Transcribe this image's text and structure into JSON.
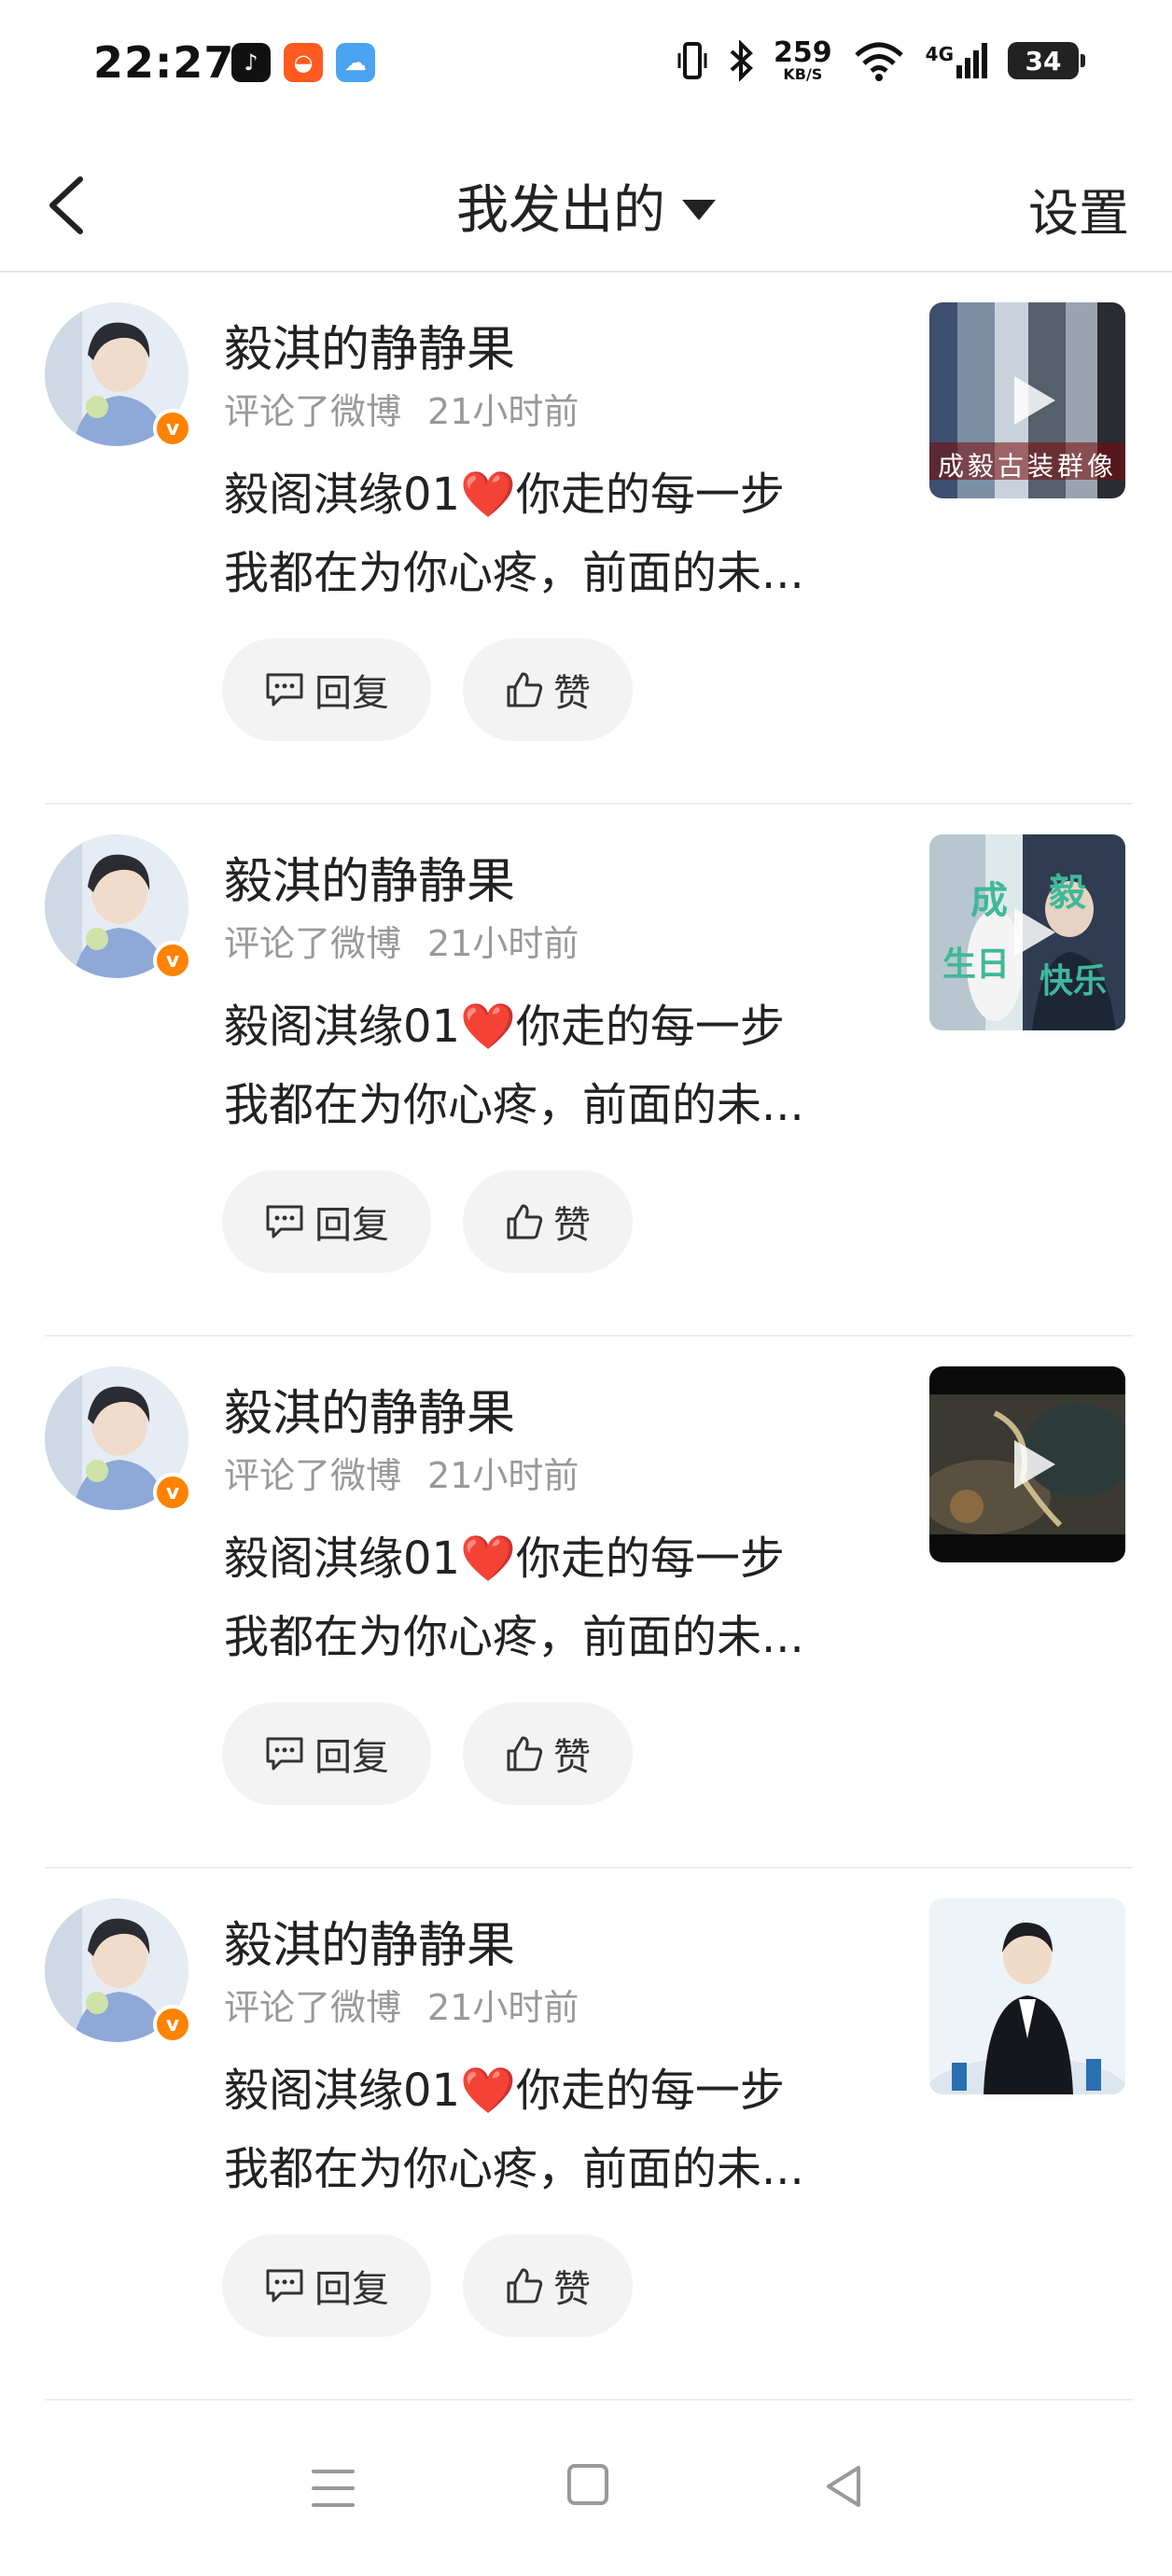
{
  "status_bar": {
    "time": "22:27",
    "net_speed": "259",
    "net_unit": "KB/S",
    "network": "4G",
    "battery": "34",
    "apps": [
      "tiktok-icon",
      "red-app-icon",
      "weather-icon"
    ]
  },
  "header": {
    "title": "我发出的",
    "settings": "设置"
  },
  "items": [
    {
      "name": "毅淇的静静果",
      "action": "评论了微博",
      "time": "21小时前",
      "text_a": "毅阁淇缘01",
      "heart": "❤️",
      "text_b": "你走的每一步",
      "line2": "我都在为你心疼，前面的未...",
      "reply": "回复",
      "like": "赞",
      "thumb": "video-collage"
    },
    {
      "name": "毅淇的静静果",
      "action": "评论了微博",
      "time": "21小时前",
      "text_a": "毅阁淇缘01",
      "heart": "❤️",
      "text_b": "你走的每一步",
      "line2": "我都在为你心疼，前面的未...",
      "reply": "回复",
      "like": "赞",
      "thumb": "video-birthday",
      "thumb_text": [
        "成",
        "毅",
        "生日",
        "快乐"
      ]
    },
    {
      "name": "毅淇的静静果",
      "action": "评论了微博",
      "time": "21小时前",
      "text_a": "毅阁淇缘01",
      "heart": "❤️",
      "text_b": "你走的每一步",
      "line2": "我都在为你心疼，前面的未...",
      "reply": "回复",
      "like": "赞",
      "thumb": "video-dark"
    },
    {
      "name": "毅淇的静静果",
      "action": "评论了微博",
      "time": "21小时前",
      "text_a": "毅阁淇缘01",
      "heart": "❤️",
      "text_b": "你走的每一步",
      "line2": "我都在为你心疼，前面的未...",
      "reply": "回复",
      "like": "赞",
      "thumb": "photo-person"
    }
  ],
  "thumb1_text": "成毅古装群像",
  "navbar": [
    "menu-icon",
    "home-icon",
    "back-icon"
  ]
}
